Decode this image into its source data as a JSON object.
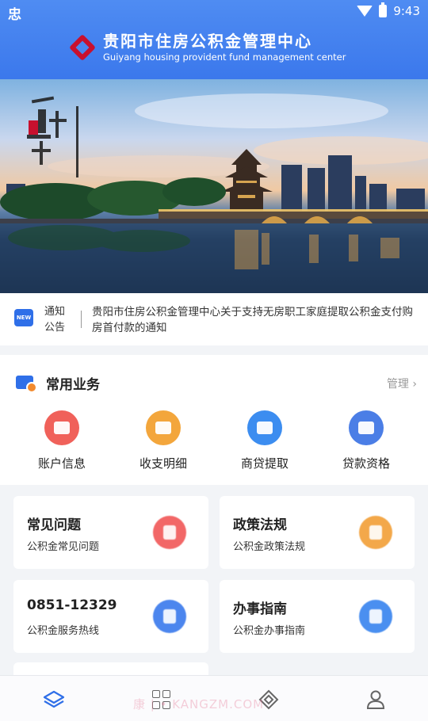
{
  "status_bar": {
    "time": "9:43",
    "left_icon": "忠"
  },
  "header": {
    "title": "贵阳市住房公积金管理中心",
    "subtitle": "Guiyang housing provident fund management center"
  },
  "notice": {
    "badge": "NEW",
    "label_line1": "通知",
    "label_line2": "公告",
    "text": "贵阳市住房公积金管理中心关于支持无房职工家庭提取公积金支付购房首付款的通知"
  },
  "services": {
    "title": "常用业务",
    "manage_label": "管理",
    "items": [
      {
        "label": "账户信息",
        "icon": "wallet-icon",
        "color": "#f0615a"
      },
      {
        "label": "收支明细",
        "icon": "receipt-icon",
        "color": "#f3a63c"
      },
      {
        "label": "商贷提取",
        "icon": "card-icon",
        "color": "#3c8df0"
      },
      {
        "label": "贷款资格",
        "icon": "calculator-icon",
        "color": "#4b7ee6"
      }
    ]
  },
  "cards": [
    {
      "title": "常见问题",
      "subtitle": "公积金常见问题",
      "icon": "document-icon",
      "color": "#f26767"
    },
    {
      "title": "政策法规",
      "subtitle": "公积金政策法规",
      "icon": "pen-icon",
      "color": "#f3a84a"
    },
    {
      "title": "0851-12329",
      "subtitle": "公积金服务热线",
      "icon": "phone-icon",
      "color": "#4c86ee"
    },
    {
      "title": "办事指南",
      "subtitle": "公积金办事指南",
      "icon": "guide-icon",
      "color": "#4a8ff0"
    }
  ],
  "watermark": "康 | • KANGZM.COM",
  "colors": {
    "primary": "#3b78ec",
    "nav_active": "#2f6fe8"
  }
}
